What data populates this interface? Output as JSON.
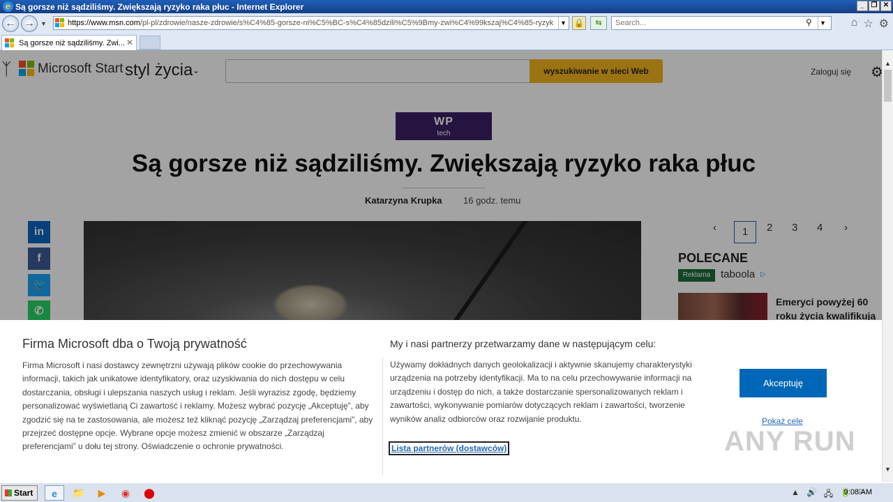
{
  "window": {
    "title": "Są gorsze niż sądziliśmy. Zwiększają ryzyko raka płuc - Internet Explorer"
  },
  "browser": {
    "url_host": "https://www.msn.com",
    "url_rest": "/pl-pl/zdrowie/nasze-zdrowie/s%C4%85-gorsze-ni%C5%BC-s%C4%85dzili%C5%9Bmy-zwi%C4%99kszaj%C4%85-ryzyk",
    "search_placeholder": "Search...",
    "tab_title": "Są gorsze niż sądziliśmy. Zwi..."
  },
  "header": {
    "brand": "Microsoft Start",
    "section": "styl życia",
    "search_button": "wyszukiwanie w sieci Web",
    "signin": "Zaloguj się"
  },
  "article": {
    "source_logo_main": "WP",
    "source_logo_sub": "tech",
    "headline": "Są gorsze niż sądziliśmy. Zwiększają ryzyko raka płuc",
    "author": "Katarzyna Krupka",
    "time": "16 godz. temu"
  },
  "share": [
    {
      "name": "linkedin-share",
      "glyph": "in",
      "color": "#0a66c2"
    },
    {
      "name": "facebook-share",
      "glyph": "f",
      "color": "#3b5998"
    },
    {
      "name": "twitter-share",
      "glyph": "🐦",
      "color": "#1da1f2"
    },
    {
      "name": "whatsapp-share",
      "glyph": "✆",
      "color": "#25d366"
    }
  ],
  "pager": {
    "prev": "‹",
    "pages": [
      "1",
      "2",
      "3",
      "4"
    ],
    "next": "›",
    "active": 0
  },
  "sidebar": {
    "heading": "POLECANE",
    "ad_badge": "Reklama",
    "ad_network": "taboola",
    "promo_title": "Emeryci powyżej 60 roku życia kwalifikują"
  },
  "privacy": {
    "title": "Firma Microsoft dba o Twoją prywatność",
    "body": "Firma Microsoft i nasi dostawcy zewnętrzni używają plików cookie do przechowywania informacji, takich jak unikatowe identyfikatory, oraz uzyskiwania do nich dostępu w celu dostarczania, obsługi i ulepszania naszych usług i reklam. Jeśli wyrazisz zgodę, będziemy personalizować wyświetlaną Ci zawartość i reklamy. Możesz wybrać pozycję „Akceptuję”, aby zgodzić się na te zastosowania, ale możesz też kliknąć pozycję „Zarządzaj preferencjami”, aby przejrzeć dostępne opcje. Wybrane opcje możesz zmienić w obszarze „Zarządzaj preferencjami” u dołu tej strony. Oświadczenie o ochronie prywatności.",
    "purpose_title": "My i nasi partnerzy przetwarzamy dane w następującym celu:",
    "purpose_body": "Używamy dokładnych danych geolokalizacji i aktywnie skanujemy charakterystyki urządzenia na potrzeby identyfikacji. Ma to na celu przechowywanie informacji na urządzeniu i dostęp do nich, a także dostarczanie spersonalizowanych reklam i zawartości, wykonywanie pomiarów dotyczących reklam i zawartości, tworzenie wyników analiz odbiorców oraz rozwijanie produktu.",
    "partners_link": "Lista partnerów (dostawców)",
    "accept_button": "Akceptuję",
    "more_link": "Pokaż cele"
  },
  "watermark": "ANY RUN",
  "taskbar": {
    "start_label": "Start",
    "clock": "9:08 AM"
  }
}
